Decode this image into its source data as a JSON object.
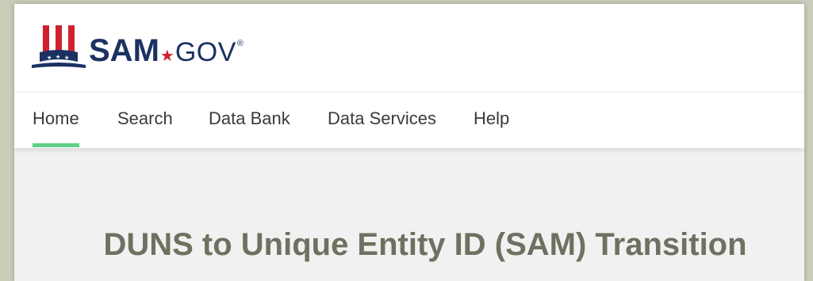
{
  "logo": {
    "brand": "SAM",
    "dot": "★",
    "suffix": "GOV",
    "registered": "®",
    "icon": "uncle-sam-hat-icon",
    "colors": {
      "navy": "#1b3161",
      "red": "#d0202e"
    }
  },
  "nav": {
    "items": [
      {
        "label": "Home",
        "active": true
      },
      {
        "label": "Search",
        "active": false
      },
      {
        "label": "Data Bank",
        "active": false
      },
      {
        "label": "Data Services",
        "active": false
      },
      {
        "label": "Help",
        "active": false
      }
    ],
    "active_color": "#5fd08a"
  },
  "main": {
    "headline": "DUNS to Unique Entity ID (SAM) Transition"
  }
}
